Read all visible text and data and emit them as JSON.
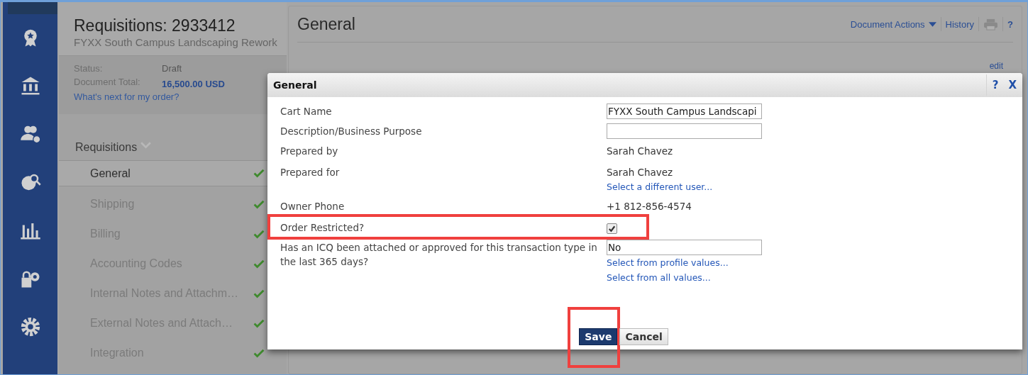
{
  "header": {
    "title": "Requisitions: 2933412",
    "subtitle": "FYXX South Campus Landscaping Rework",
    "status_label": "Status:",
    "status_value": "Draft",
    "total_label": "Document Total:",
    "total_value": "16,500.00  USD",
    "next_link": "What's next for my order?"
  },
  "nav": {
    "heading": "Requisitions",
    "items": [
      {
        "label": "General",
        "selected": true,
        "complete": true
      },
      {
        "label": "Shipping",
        "selected": false,
        "complete": true
      },
      {
        "label": "Billing",
        "selected": false,
        "complete": true
      },
      {
        "label": "Accounting Codes",
        "selected": false,
        "complete": true
      },
      {
        "label": "Internal Notes and Attachm…",
        "selected": false,
        "complete": true
      },
      {
        "label": "External Notes and Attach…",
        "selected": false,
        "complete": true
      },
      {
        "label": "Integration",
        "selected": false,
        "complete": true
      }
    ]
  },
  "main": {
    "title": "General",
    "actions": [
      "Document Actions",
      "History"
    ],
    "help": "?",
    "edit_link": "edit"
  },
  "dialog": {
    "title": "General",
    "help": "?",
    "close": "X",
    "fields": [
      {
        "kind": "input",
        "label": "Cart Name",
        "value": "FYXX South Campus Landscapi"
      },
      {
        "kind": "input",
        "label": "Description/Business Purpose"
      },
      {
        "kind": "text",
        "label": "Prepared by",
        "value": "Sarah Chavez"
      },
      {
        "kind": "text",
        "label": "Prepared for",
        "value": "Sarah Chavez",
        "links": [
          "Select a different user..."
        ]
      },
      {
        "kind": "text",
        "label": "Owner Phone",
        "value": "+1 812-856-4574"
      },
      {
        "kind": "checkbox",
        "label": "Order Restricted?",
        "checked": true,
        "highlighted": true
      },
      {
        "kind": "input",
        "label": "Has an ICQ been attached or approved for this transaction type in the last 365 days?",
        "value": "No",
        "links": [
          "Select from profile values...",
          "Select from all values..."
        ]
      }
    ],
    "buttons": [
      {
        "label": "Save",
        "primary": true,
        "highlighted": true
      },
      {
        "label": "Cancel",
        "primary": false,
        "highlighted": false
      }
    ]
  }
}
